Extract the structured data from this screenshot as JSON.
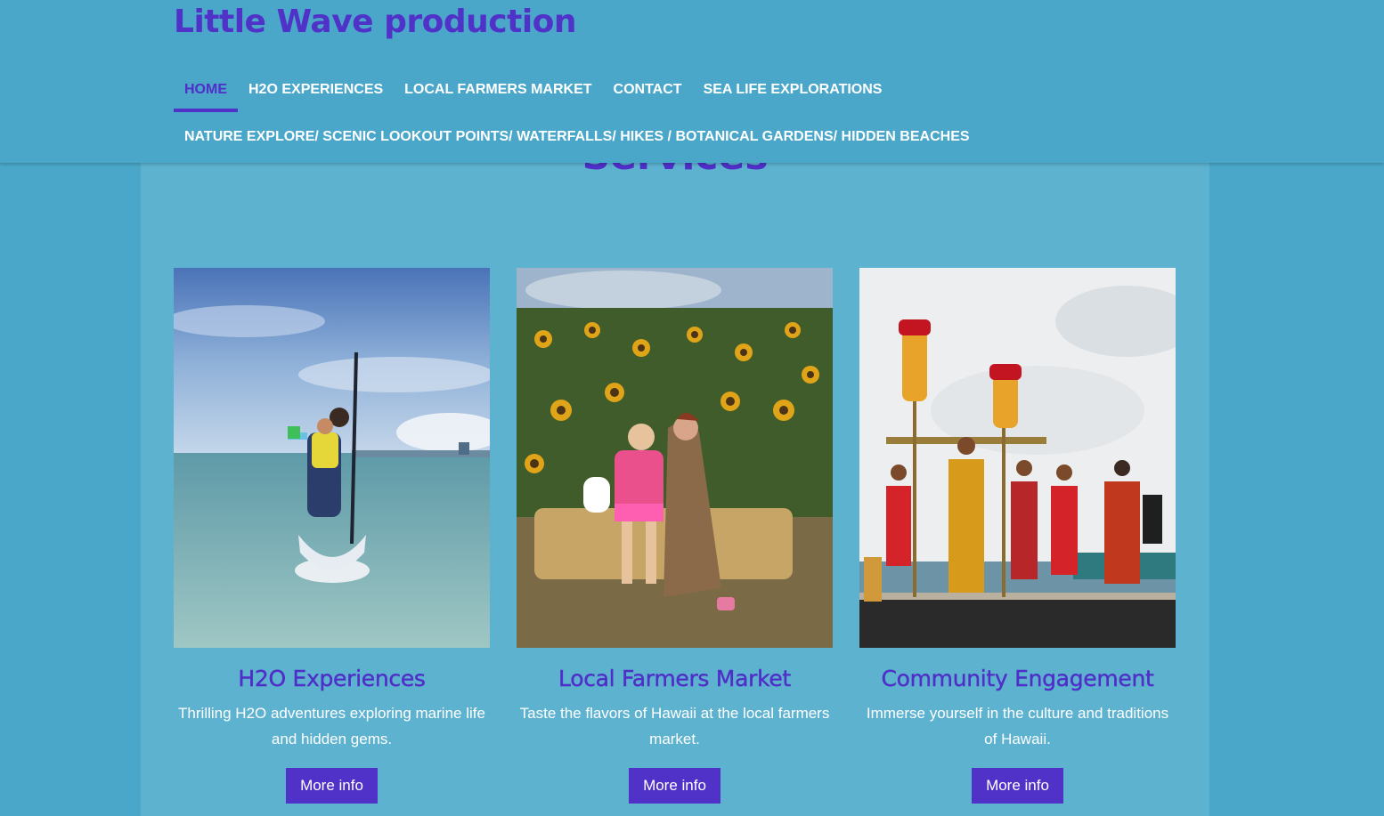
{
  "brand": {
    "title": "Little Wave production"
  },
  "nav": {
    "row1": [
      {
        "label": "HOME",
        "active": true
      },
      {
        "label": "H2O EXPERIENCES",
        "active": false
      },
      {
        "label": "LOCAL FARMERS MARKET",
        "active": false
      },
      {
        "label": "CONTACT",
        "active": false
      },
      {
        "label": "SEA LIFE EXPLORATIONS",
        "active": false
      }
    ],
    "row2": [
      {
        "label": "NATURE EXPLORE/ SCENIC LOOKOUT POINTS/ WATERFALLS/ HIKES / BOTANICAL GARDENS/ HIDDEN BEACHES",
        "active": false
      }
    ]
  },
  "services": {
    "title": "Services",
    "cards": [
      {
        "title": "H2O Experiences",
        "description": "Thrilling H2O adventures exploring marine life and hidden gems.",
        "button": "More info"
      },
      {
        "title": "Local Farmers Market",
        "description": "Taste the flavors of Hawaii at the local farmers market.",
        "button": "More info"
      },
      {
        "title": "Community Engagement",
        "description": "Immerse yourself in the culture and traditions of Hawaii.",
        "button": "More info"
      }
    ]
  },
  "colors": {
    "background": "#4aa7c9",
    "panel": "#5db2d0",
    "accent": "#5132c9",
    "text_light": "#ffffff"
  }
}
